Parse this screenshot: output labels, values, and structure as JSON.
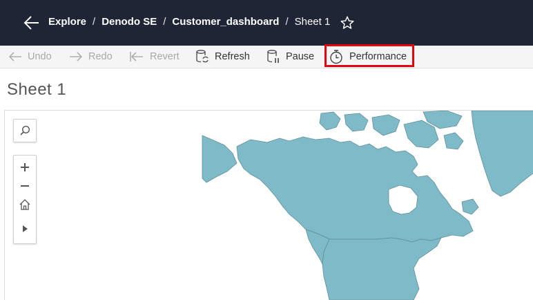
{
  "header": {
    "breadcrumbs": [
      "Explore",
      "Denodo SE",
      "Customer_dashboard",
      "Sheet 1"
    ],
    "separator": "/"
  },
  "toolbar": {
    "undo": "Undo",
    "redo": "Redo",
    "revert": "Revert",
    "refresh": "Refresh",
    "pause": "Pause",
    "performance": "Performance"
  },
  "sheet": {
    "title": "Sheet 1"
  },
  "colors": {
    "header_bg": "#1f2535",
    "land_fill": "#7fbac8",
    "land_stroke": "#5f8f99",
    "highlight": "#e3000f"
  },
  "icons": [
    "back-arrow-icon",
    "star-icon",
    "undo-icon",
    "redo-icon",
    "revert-icon",
    "refresh-icon",
    "pause-icon",
    "stopwatch-icon",
    "search-icon",
    "zoom-in-icon",
    "zoom-out-icon",
    "home-icon",
    "play-icon"
  ]
}
